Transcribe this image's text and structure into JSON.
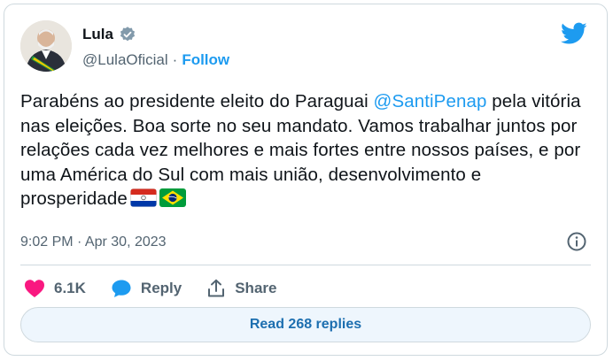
{
  "author": {
    "name": "Lula",
    "handle": "@LulaOficial",
    "separator": "·",
    "follow_label": "Follow"
  },
  "tweet": {
    "text_before": "Parabéns ao presidente eleito do Paraguai ",
    "mention": "@SantiPenap",
    "text_after": " pela vitória nas eleições. Boa sorte no seu mandato. Vamos trabalhar juntos por relações cada vez melhores e mais fortes entre nossos países, e por uma América do Sul com mais união, desenvolvimento e prosperidade"
  },
  "meta": {
    "timestamp": "9:02 PM · Apr 30, 2023"
  },
  "actions": {
    "like_count": "6.1K",
    "reply_label": "Reply",
    "share_label": "Share"
  },
  "read_replies_label": "Read 268 replies",
  "colors": {
    "accent": "#1d9bf0",
    "like": "#f91880",
    "text": "#0f1419",
    "muted": "#536471",
    "border": "#cfd9de"
  },
  "icons": [
    "verified-badge-icon",
    "twitter-bird-icon",
    "paraguay-flag-icon",
    "brazil-flag-icon",
    "info-icon",
    "heart-icon",
    "reply-bubble-icon",
    "share-icon"
  ]
}
